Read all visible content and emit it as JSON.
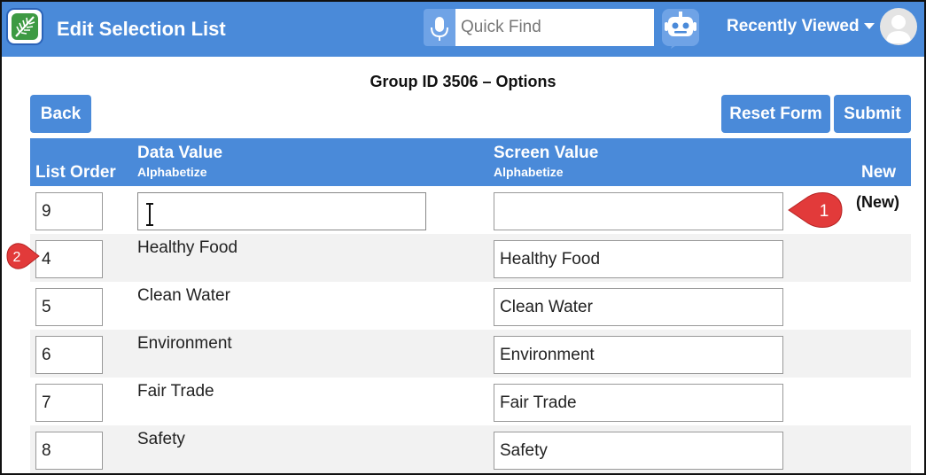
{
  "topbar": {
    "title": "Edit Selection List",
    "search_placeholder": "Quick Find",
    "recently_viewed": "Recently Viewed"
  },
  "page": {
    "heading": "Group ID 3506 – Options",
    "back_label": "Back",
    "reset_label": "Reset Form",
    "submit_label": "Submit"
  },
  "table": {
    "headers": {
      "list_order": "List Order",
      "data_value": "Data Value",
      "data_value_sub": "Alphabetize",
      "screen_value": "Screen Value",
      "screen_value_sub": "Alphabetize",
      "new": "New"
    },
    "new_row": {
      "order": "9",
      "data": "",
      "screen": "",
      "label": "(New)"
    },
    "rows": [
      {
        "order": "4",
        "data": "Healthy Food",
        "screen": "Healthy Food"
      },
      {
        "order": "5",
        "data": "Clean Water",
        "screen": "Clean Water"
      },
      {
        "order": "6",
        "data": "Environment",
        "screen": "Environment"
      },
      {
        "order": "7",
        "data": "Fair Trade",
        "screen": "Fair Trade"
      },
      {
        "order": "8",
        "data": "Safety",
        "screen": "Safety"
      }
    ]
  },
  "callouts": {
    "first": "1",
    "second": "2"
  },
  "icons": {
    "logo": "leaf-logo-icon",
    "mic": "microphone-icon",
    "bot": "robot-icon",
    "caret": "caret-down-icon",
    "avatar": "user-avatar-icon",
    "cursor": "text-cursor-icon"
  },
  "colors": {
    "accent": "#4a8ad9",
    "callout": "#e23a3a",
    "row_alt": "#f2f2f2"
  }
}
